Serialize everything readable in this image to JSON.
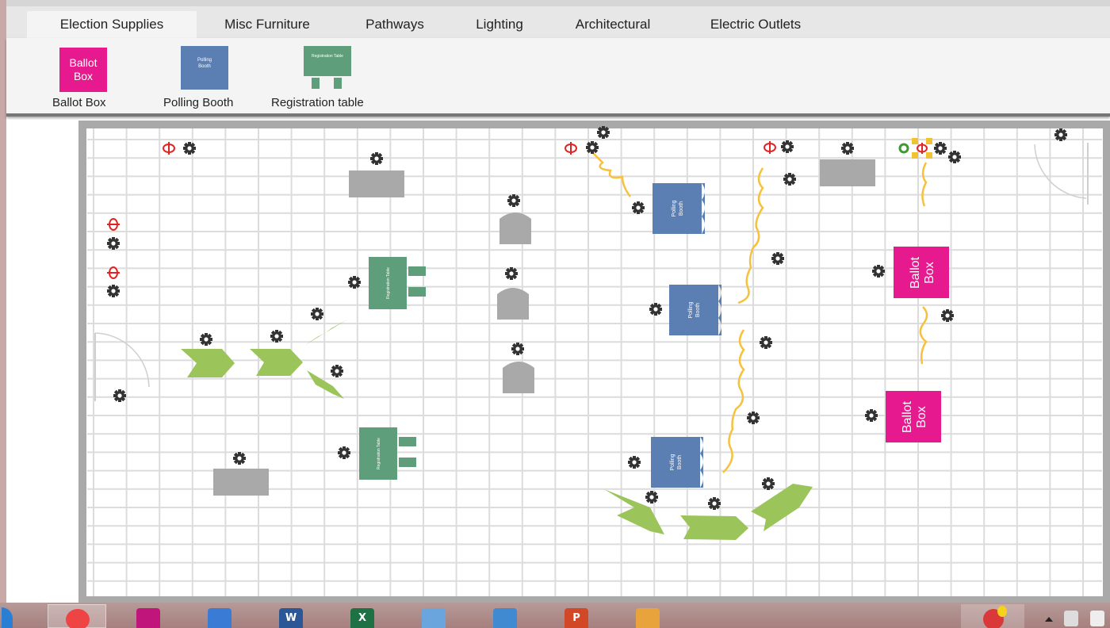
{
  "tabs": [
    {
      "label": "Election Supplies",
      "active": true
    },
    {
      "label": "Misc Furniture"
    },
    {
      "label": "Pathways"
    },
    {
      "label": "Lighting"
    },
    {
      "label": "Architectural"
    },
    {
      "label": "Electric Outlets"
    }
  ],
  "palette": {
    "items": [
      {
        "name": "Ballot Box",
        "icon_text": "Ballot Box"
      },
      {
        "name": "Polling Booth",
        "icon_text": "Polling Booth"
      },
      {
        "name": "Registration table",
        "icon_text": "Registration Table"
      }
    ]
  },
  "canvas": {
    "ballot_box_text": "Ballot Box",
    "polling_booth_text": "Polling Booth",
    "registration_table_text": "Registration Table",
    "colors": {
      "ballot_box": "#e6198e",
      "polling_booth": "#5b7fb3",
      "registration_table": "#5e9e7a",
      "pathway": "#9bc45a",
      "furniture": "#a9a9a9",
      "electric_cord": "#f6c13d",
      "outlet": "#e02424",
      "grid": "#dcdcdc",
      "wall": "#a9a9a9"
    }
  },
  "taskbar": {
    "apps": [
      {
        "icon": "chrome-icon",
        "label": ""
      },
      {
        "icon": "camera-app-icon",
        "label": ""
      },
      {
        "icon": "photo-viewer-icon",
        "label": ""
      },
      {
        "icon": "word-icon",
        "label": "W"
      },
      {
        "icon": "excel-icon",
        "label": "X"
      },
      {
        "icon": "people-icon",
        "label": ""
      },
      {
        "icon": "control-panel-icon",
        "label": ""
      },
      {
        "icon": "powerpoint-icon",
        "label": "P"
      },
      {
        "icon": "paint-icon",
        "label": ""
      }
    ]
  }
}
